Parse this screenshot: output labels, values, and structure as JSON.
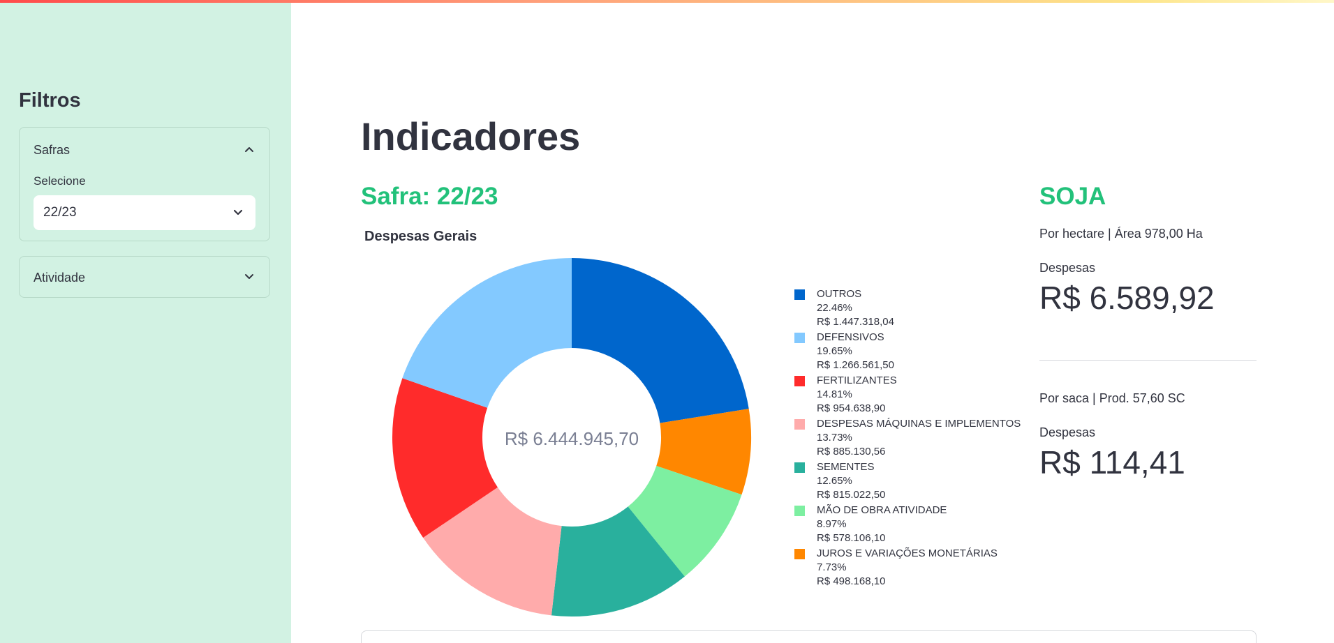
{
  "sidebar": {
    "title": "Filtros",
    "safras": {
      "label": "Safras",
      "select_label": "Selecione",
      "selected": "22/23"
    },
    "atividade": {
      "label": "Atividade"
    }
  },
  "main": {
    "title": "Indicadores",
    "safra_title": "Safra: 22/23",
    "chart_title": "Despesas Gerais"
  },
  "chart_data": {
    "type": "pie",
    "title": "Despesas Gerais",
    "center_label": "R$ 6.444.945,70",
    "legend_position": "right",
    "slices": [
      {
        "label": "OUTROS",
        "percent_text": "22.46%",
        "amount": "R$ 1.447.318,04",
        "value": 1447318.04,
        "color": "#0066cc"
      },
      {
        "label": "JUROS E VARIAÇÕES MONETÁRIAS",
        "percent_text": "7.73%",
        "amount": "R$ 498.168,10",
        "value": 498168.1,
        "color": "#ff8700"
      },
      {
        "label": "MÃO DE OBRA ATIVIDADE",
        "percent_text": "8.97%",
        "amount": "R$ 578.106,10",
        "value": 578106.1,
        "color": "#7defa1"
      },
      {
        "label": "SEMENTES",
        "percent_text": "12.65%",
        "amount": "R$ 815.022,50",
        "value": 815022.5,
        "color": "#29b09d"
      },
      {
        "label": "DESPESAS MÁQUINAS E IMPLEMENTOS",
        "percent_text": "13.73%",
        "amount": "R$ 885.130,56",
        "value": 885130.56,
        "color": "#ffabab"
      },
      {
        "label": "FERTILIZANTES",
        "percent_text": "14.81%",
        "amount": "R$ 954.638,90",
        "value": 954638.9,
        "color": "#ff2b2b"
      },
      {
        "label": "DEFENSIVOS",
        "percent_text": "19.65%",
        "amount": "R$ 1.266.561,50",
        "value": 1266561.5,
        "color": "#83c9ff"
      }
    ],
    "legend_order": [
      0,
      6,
      5,
      4,
      3,
      2,
      1
    ]
  },
  "stats": {
    "crop": "SOJA",
    "per_hectare": {
      "caption": "Por hectare | Área 978,00 Ha",
      "label": "Despesas",
      "value": "R$ 6.589,92"
    },
    "per_saca": {
      "caption": "Por saca | Prod. 57,60 SC",
      "label": "Despesas",
      "value": "R$ 114,41"
    }
  },
  "icons": {
    "collapse": "chevron-up-icon",
    "expand": "chevron-down-icon"
  }
}
